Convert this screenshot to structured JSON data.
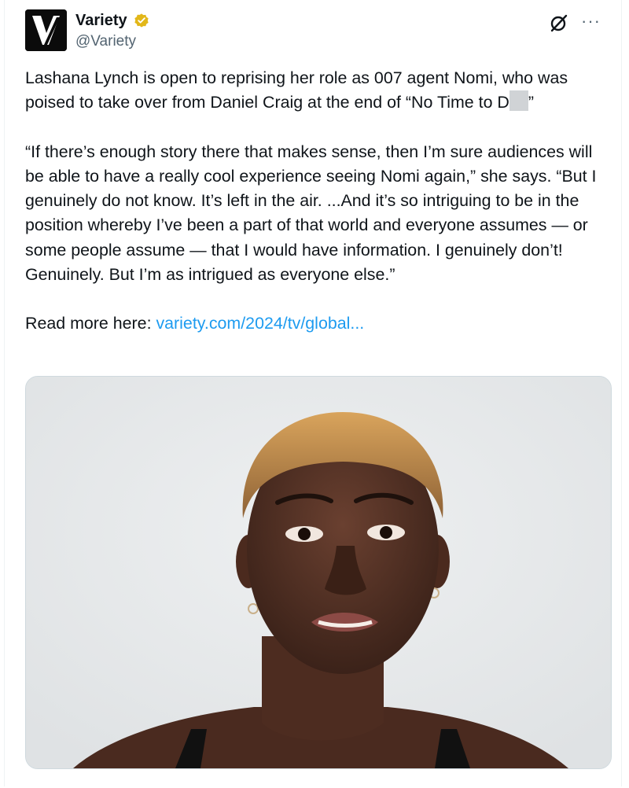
{
  "author": {
    "display_name": "Variety",
    "handle": "@Variety",
    "verified_badge": "gold-check-icon",
    "avatar_letter": "V"
  },
  "header_actions": {
    "grok_icon": "grok-icon",
    "more_label": "···"
  },
  "tweet": {
    "paragraph_1_a": "Lashana Lynch is open to reprising her role as 007 agent Nomi, who was poised to take over from Daniel Craig at the end of “No Time to D",
    "paragraph_1_b": "”",
    "paragraph_2": "“If there’s enough story there that makes sense, then I’m sure audiences will be able to have a really cool experience seeing Nomi again,” she says. “But I genuinely do not know. It’s left in the air. ...And it’s so intriguing to be in the position whereby I’ve been a part of that world and everyone assumes — or some people assume — that I would have information. I genuinely don’t! Genuinely. But I’m as intrigued as everyone else.”",
    "read_more_label": "Read more here: ",
    "link_text": "variety.com/2024/tv/global..."
  },
  "media": {
    "type": "photo",
    "subject": "portrait-photo"
  },
  "colors": {
    "link": "#1d9bf0",
    "badge": "#e2b719",
    "handle": "#536471"
  }
}
